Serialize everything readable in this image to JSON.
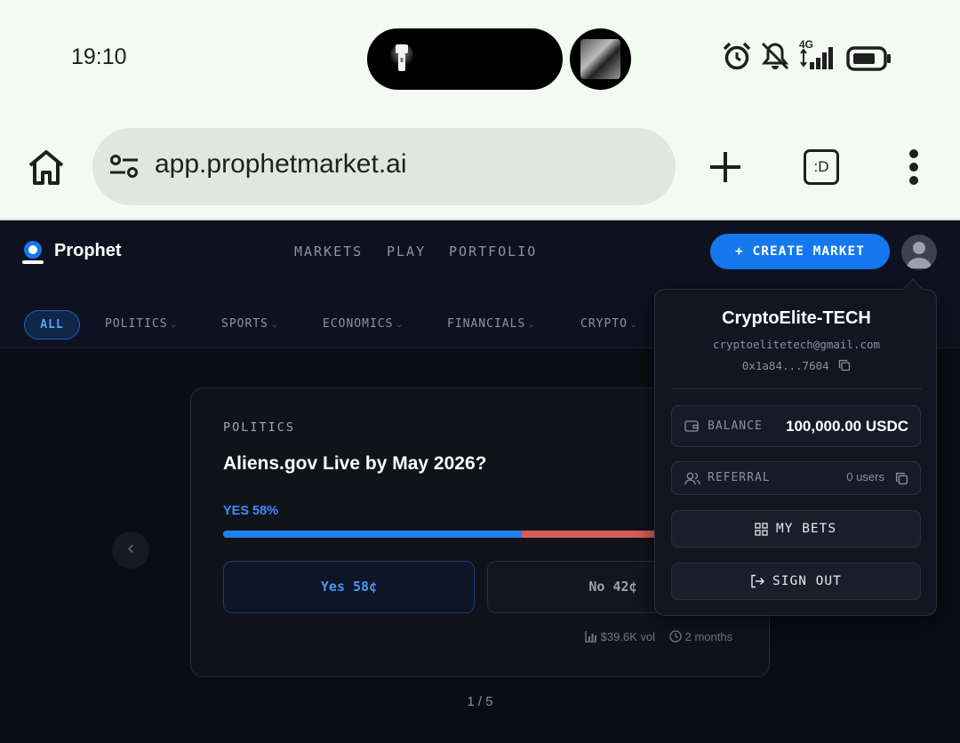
{
  "status_bar": {
    "time": "19:10",
    "network": "4G",
    "icons": [
      "flashlight-icon",
      "album-art",
      "alarm-icon",
      "mute-icon",
      "signal-icon",
      "battery-icon"
    ]
  },
  "browser": {
    "url": "app.prophetmarket.ai",
    "tabs_label": ":D",
    "icons": [
      "home-icon",
      "tune-icon",
      "plus-icon",
      "tabs-icon",
      "more-vert-icon"
    ]
  },
  "app": {
    "brand": "Prophet",
    "nav": [
      "MARKETS",
      "PLAY",
      "PORTFOLIO"
    ],
    "create_label": "+ CREATE MARKET",
    "categories": {
      "active": "ALL",
      "items": [
        "POLITICS",
        "SPORTS",
        "ECONOMICS",
        "FINANCIALS",
        "CRYPTO"
      ]
    }
  },
  "market": {
    "category": "POLITICS",
    "title": "Aliens.gov Live by May 2026?",
    "yes_label": "YES 58%",
    "yes_fraction": 0.58,
    "yes_button": "Yes 58¢",
    "no_button": "No 42¢",
    "volume": "$39.6K vol",
    "time_left": "2 months",
    "pager": "1 / 5"
  },
  "account": {
    "name": "CryptoElite-TECH",
    "email": "cryptoelitetech@gmail.com",
    "address": "0x1a84...7604",
    "balance_label": "BALANCE",
    "balance_value": "100,000.00 USDC",
    "referral_label": "REFERRAL",
    "referral_value": "0 users",
    "my_bets_label": "MY BETS",
    "sign_out_label": "SIGN OUT"
  },
  "colors": {
    "accent": "#1478ee",
    "yes": "#2080f0",
    "no": "#d65c5c",
    "background": "#0b0d14"
  }
}
